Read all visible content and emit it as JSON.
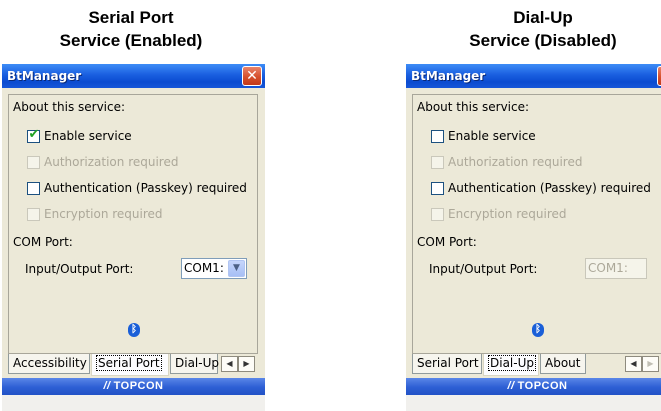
{
  "left": {
    "caption_line1": "Serial Port",
    "caption_line2": "Service (Enabled)",
    "window_title": "BtManager",
    "close_glyph": "✕",
    "section_about": "About this service:",
    "checkboxes": [
      {
        "label": "Enable service",
        "checked": true,
        "enabled": true
      },
      {
        "label": "Authorization required",
        "checked": false,
        "enabled": false
      },
      {
        "label": "Authentication (Passkey) required",
        "checked": false,
        "enabled": true
      },
      {
        "label": "Encryption required",
        "checked": false,
        "enabled": false
      }
    ],
    "section_com": "COM Port:",
    "io_label": "Input/Output Port:",
    "io_value": "COM1:",
    "io_enabled": true,
    "tabs": [
      "Accessibility",
      "Serial Port",
      "Dial-Up"
    ],
    "active_tab": "Serial Port",
    "footer_brand": "TOPCON"
  },
  "right": {
    "caption_line1": "Dial-Up",
    "caption_line2": "Service (Disabled)",
    "window_title": "BtManager",
    "close_glyph": "✕",
    "section_about": "About this service:",
    "checkboxes": [
      {
        "label": "Enable service",
        "checked": false,
        "enabled": true
      },
      {
        "label": "Authorization required",
        "checked": false,
        "enabled": false
      },
      {
        "label": "Authentication (Passkey) required",
        "checked": false,
        "enabled": true
      },
      {
        "label": "Encryption required",
        "checked": false,
        "enabled": false
      }
    ],
    "section_com": "COM Port:",
    "io_label": "Input/Output Port:",
    "io_value": "COM1:",
    "io_enabled": false,
    "tabs": [
      "Serial Port",
      "Dial-Up",
      "About"
    ],
    "active_tab": "Dial-Up",
    "footer_brand": "TOPCON"
  },
  "icons": {
    "bluetooth": "bluetooth-icon",
    "tab_scroll_left": "arrow-left-icon",
    "tab_scroll_right": "arrow-right-icon",
    "combo_dropdown": "chevron-down-icon",
    "checkmark": "checkmark-icon",
    "close": "close-icon",
    "brand_mark": "topcon-logo-icon"
  },
  "colors": {
    "titlebar": "#1a5fe0",
    "window_bg": "#ece9d8",
    "checkmark": "#21a121",
    "footer": "#2d5fd4",
    "close": "#d6502c"
  }
}
